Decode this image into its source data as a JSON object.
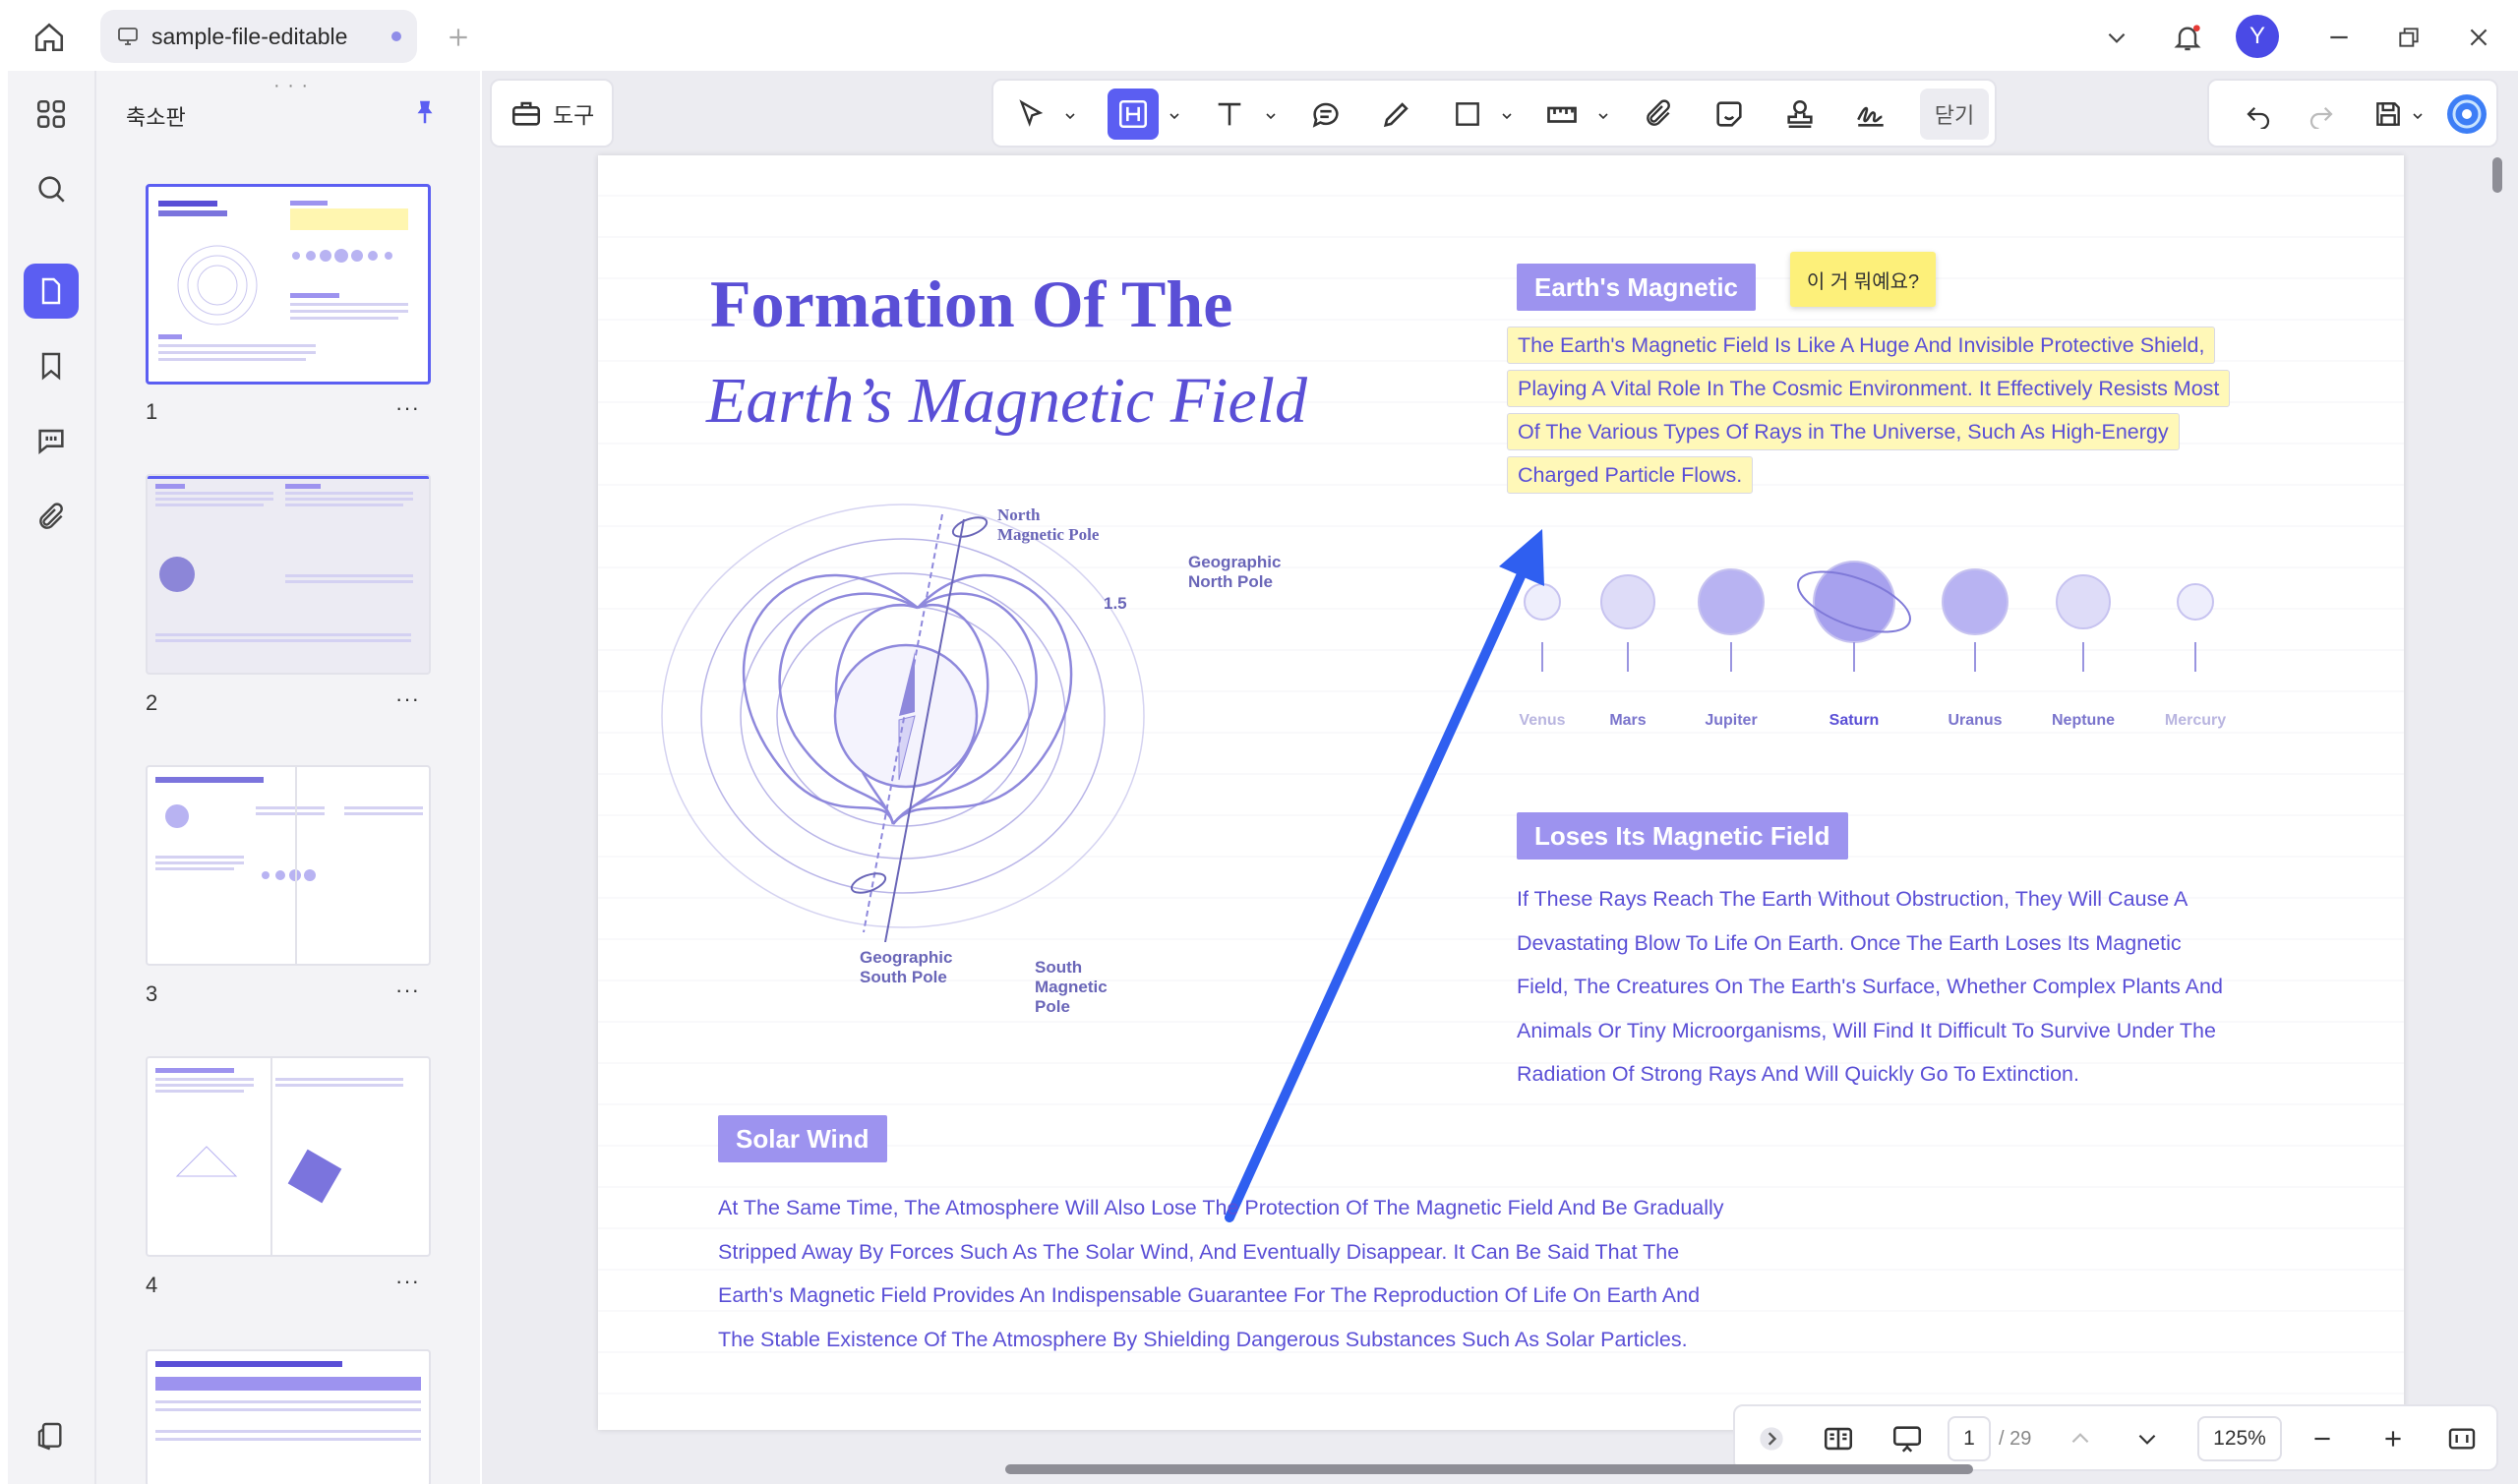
{
  "window": {
    "tab_title": "sample-file-editable"
  },
  "user": {
    "avatar_initial": "Y"
  },
  "thumbnails_panel": {
    "title": "축소판",
    "pages": [
      {
        "number": "1",
        "more": "···"
      },
      {
        "number": "2",
        "more": "···"
      },
      {
        "number": "3",
        "more": "···"
      },
      {
        "number": "4",
        "more": "···"
      }
    ]
  },
  "toolbar": {
    "tools_label": "도구",
    "close_label": "닫기"
  },
  "document": {
    "title_line1": "Formation Of The",
    "title_line2": "Earth’s Magnetic Field",
    "section1_label": "Earth's Magnetic",
    "sticky_note": "이 거 뭐예요?",
    "section1_lines": [
      "The Earth's Magnetic Field Is Like A Huge And Invisible Protective Shield,",
      "Playing A Vital Role In The Cosmic Environment. It Effectively Resists Most",
      "Of The Various Types Of Rays in The Universe, Such As High-Energy",
      "Charged Particle Flows."
    ],
    "planets": [
      "Venus",
      "Mars",
      "Jupiter",
      "Saturn",
      "Uranus",
      "Neptune",
      "Mercury"
    ],
    "diagram_labels": {
      "north_magnetic_pole": [
        "North",
        "Magnetic Pole"
      ],
      "geographic_north_pole": [
        "Geographic",
        "North Pole"
      ],
      "geographic_south_pole": [
        "Geographic",
        "South Pole"
      ],
      "south_magnetic_pole": [
        "South",
        "Magnetic",
        "Pole"
      ],
      "angle": "1.5"
    },
    "section2_label": "Loses Its Magnetic Field",
    "section2_lines": [
      "If These Rays Reach The Earth Without Obstruction, They Will Cause A",
      "Devastating Blow To Life On Earth. Once The Earth Loses Its Magnetic",
      "Field, The Creatures On The Earth's Surface, Whether Complex Plants And",
      "Animals Or Tiny Microorganisms, Will Find It Difficult To Survive Under The",
      "Radiation Of Strong Rays And Will Quickly Go To Extinction."
    ],
    "section3_label": "Solar Wind",
    "section3_lines": [
      "At The Same Time, The Atmosphere Will Also Lose The Protection Of The Magnetic Field And Be Gradually",
      "Stripped Away By Forces Such As The Solar Wind, And Eventually Disappear. It Can Be Said That The",
      "Earth's Magnetic Field Provides An Indispensable Guarantee For The Reproduction Of Life On Earth And",
      "The Stable Existence Of The Atmosphere By Shielding Dangerous Substances Such As Solar Particles."
    ]
  },
  "status_bar": {
    "current_page": "1",
    "total_pages": "/ 29",
    "zoom": "125%"
  },
  "colors": {
    "accent": "#5b5ef2",
    "doc_text": "#5a4fd6",
    "label_fill": "#9d93ef",
    "highlight": "#fff8b8",
    "arrow": "#2f5ff0"
  }
}
